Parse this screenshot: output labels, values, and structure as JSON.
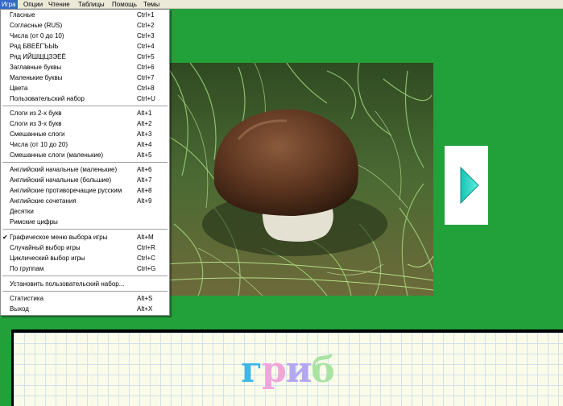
{
  "menubar": {
    "items": [
      {
        "label": "Игра",
        "active": true
      },
      {
        "label": "Опции"
      },
      {
        "label": "Чтение"
      },
      {
        "label": "Таблицы"
      },
      {
        "label": "Помощь"
      },
      {
        "label": "Темы"
      }
    ]
  },
  "dropdown": {
    "groups": [
      [
        {
          "label": "Гласные",
          "shortcut": "Ctrl+1"
        },
        {
          "label": "Согласные (RUS)",
          "shortcut": "Ctrl+2"
        },
        {
          "label": "Числа (от 0 до 10)",
          "shortcut": "Ctrl+3"
        },
        {
          "label": "Ряд БВЕЁГЪЫЬ",
          "shortcut": "Ctrl+4"
        },
        {
          "label": "Ряд ИЙШЩЦЗЭЕЁ",
          "shortcut": "Ctrl+5"
        },
        {
          "label": "Заглавные буквы",
          "shortcut": "Ctrl+6"
        },
        {
          "label": "Маленькие буквы",
          "shortcut": "Ctrl+7"
        },
        {
          "label": "Цвета",
          "shortcut": "Ctrl+8"
        },
        {
          "label": "Пользовательский набор",
          "shortcut": "Ctrl+U"
        }
      ],
      [
        {
          "label": "Слоги из 2-х букв",
          "shortcut": "Alt+1"
        },
        {
          "label": "Слоги из 3-х букв",
          "shortcut": "Alt+2"
        },
        {
          "label": "Смешанные слоги",
          "shortcut": "Alt+3"
        },
        {
          "label": "Числа (от 10 до 20)",
          "shortcut": "Alt+4"
        },
        {
          "label": "Смешанные слоги (маленькие)",
          "shortcut": "Alt+5"
        }
      ],
      [
        {
          "label": "Английский начальные (маленькие)",
          "shortcut": "Alt+6"
        },
        {
          "label": "Английский начальные (большие)",
          "shortcut": "Alt+7"
        },
        {
          "label": "Английские противоречащие русским",
          "shortcut": "Alt+8"
        },
        {
          "label": "Английские сочетания",
          "shortcut": "Alt+9"
        },
        {
          "label": "Десятки",
          "shortcut": ""
        },
        {
          "label": "Римские цифры",
          "shortcut": ""
        }
      ],
      [
        {
          "label": "Графическое меню выбора игры",
          "shortcut": "Alt+M",
          "checked": true
        },
        {
          "label": "Случайный выбор игры",
          "shortcut": "Ctrl+R"
        },
        {
          "label": "Циклический выбор игры",
          "shortcut": "Ctrl+C"
        },
        {
          "label": "По группам",
          "shortcut": "Ctrl+G"
        }
      ],
      [
        {
          "label": "Установить пользовательский набор...",
          "shortcut": ""
        }
      ],
      [
        {
          "label": "Статистика",
          "shortcut": "Alt+S"
        },
        {
          "label": "Выход",
          "shortcut": "Alt+X"
        }
      ]
    ]
  },
  "word": {
    "letters": [
      {
        "ch": "г",
        "color": "#3db7e6"
      },
      {
        "ch": "р",
        "color": "#f0a6dc"
      },
      {
        "ch": "и",
        "color": "#b3a6f2"
      },
      {
        "ch": "б",
        "color": "#a9e3a4"
      }
    ]
  },
  "colors": {
    "background": "#22a03a",
    "arrow": "#30d8c8",
    "menu_highlight": "#316ac5"
  },
  "icons": {
    "next": "play-arrow-icon",
    "check": "checkmark-icon"
  }
}
